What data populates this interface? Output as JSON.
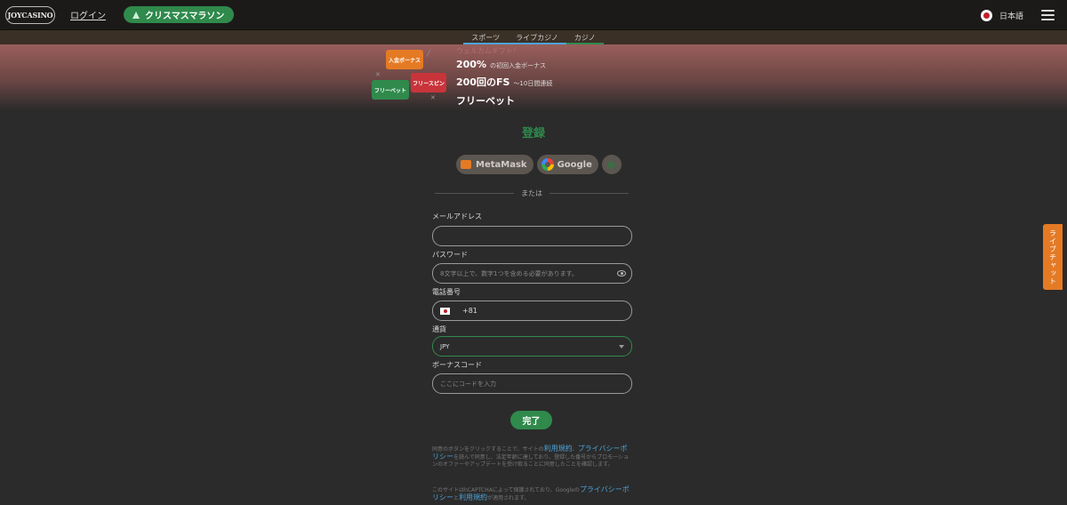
{
  "header": {
    "logo_text": "JOYCASINO",
    "login_label": "ログイン",
    "promo_label": "クリスマスマラソン",
    "language": "日本語"
  },
  "tabs": [
    {
      "label": "スポーツ"
    },
    {
      "label": "ライブカジノ"
    },
    {
      "label": "カジノ"
    }
  ],
  "banner": {
    "art": {
      "badge_deposit": "入金ボーナス",
      "badge_freebet": "フリーベット",
      "badge_freespin": "フリースピン"
    },
    "welcome": "ウェルカムギフト！",
    "line1_main": "200%",
    "line1_sub": "の初回入金ボーナス",
    "line2_main": "200回のFS",
    "line2_sub": "～10日間連続",
    "line3_main": "フリーベット"
  },
  "form": {
    "title": "登録",
    "social": {
      "metamask": "MetaMask",
      "google": "Google"
    },
    "divider": "または",
    "email": {
      "label": "メールアドレス",
      "value": "",
      "placeholder": ""
    },
    "password": {
      "label": "パスワード",
      "placeholder": "8文字以上で、数字1つを含める必要があります。"
    },
    "phone": {
      "label": "電話番号",
      "country_code": "+81"
    },
    "currency": {
      "label": "通貨",
      "value": "JPY"
    },
    "bonus": {
      "label": "ボーナスコード",
      "placeholder": "ここにコードを入力"
    },
    "submit": "完了"
  },
  "legal": {
    "p1_a": "同意のボタンをクリックすることで、サイトの",
    "terms": "利用規約",
    "p1_b": "、",
    "privacy": "プライバシーポリシー",
    "p1_c": "を読んで同意し、法定年齢に達しており、登録した番号からプロモーションのオファーやアップデートを受け取ることに同意したことを確認します。",
    "p2_a": "このサイトはhCAPTCHAによって保護されており、Googleの",
    "privacy2": "プライバシーポリシー",
    "p2_b": "と",
    "terms2": "利用規約",
    "p2_c": "が適用されます。"
  },
  "live_chat": "ライブチャット",
  "colors": {
    "accent_green": "#2f8a4c",
    "accent_orange": "#e57a24",
    "link_blue": "#4ca3d9",
    "background": "#2b2b2b"
  }
}
